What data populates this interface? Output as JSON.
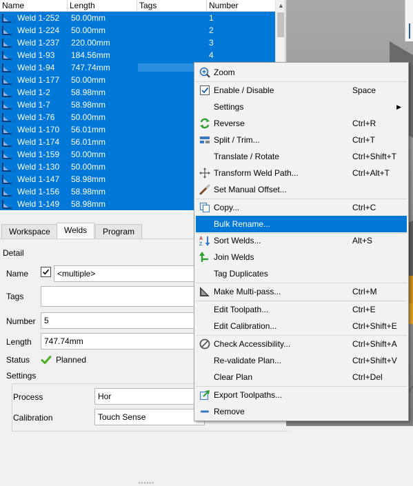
{
  "table": {
    "columns": [
      "Name",
      "Length",
      "Tags",
      "Number"
    ],
    "rows": [
      {
        "name": "Weld 1-252",
        "length": "50.00mm",
        "number": "1"
      },
      {
        "name": "Weld 1-224",
        "length": "50.00mm",
        "number": "2"
      },
      {
        "name": "Weld 1-237",
        "length": "220.00mm",
        "number": "3"
      },
      {
        "name": "Weld 1-93",
        "length": "184.56mm",
        "number": "4"
      },
      {
        "name": "Weld 1-94",
        "length": "747.74mm",
        "number": ""
      },
      {
        "name": "Weld 1-177",
        "length": "50.00mm",
        "number": ""
      },
      {
        "name": "Weld 1-2",
        "length": "58.98mm",
        "number": ""
      },
      {
        "name": "Weld 1-7",
        "length": "58.98mm",
        "number": ""
      },
      {
        "name": "Weld 1-76",
        "length": "50.00mm",
        "number": ""
      },
      {
        "name": "Weld 1-170",
        "length": "56.01mm",
        "number": ""
      },
      {
        "name": "Weld 1-174",
        "length": "56.01mm",
        "number": ""
      },
      {
        "name": "Weld 1-159",
        "length": "50.00mm",
        "number": ""
      },
      {
        "name": "Weld 1-130",
        "length": "50.00mm",
        "number": ""
      },
      {
        "name": "Weld 1-147",
        "length": "58.98mm",
        "number": ""
      },
      {
        "name": "Weld 1-156",
        "length": "58.98mm",
        "number": ""
      },
      {
        "name": "Weld 1-149",
        "length": "58.98mm",
        "number": ""
      }
    ],
    "selection_color": "#0078d7"
  },
  "tabs": [
    {
      "label": "Workspace",
      "active": false
    },
    {
      "label": "Welds",
      "active": true
    },
    {
      "label": "Program",
      "active": false
    }
  ],
  "detail": {
    "section_label": "Detail",
    "name_label": "Name",
    "name_value": "<multiple>",
    "name_checked": true,
    "tags_label": "Tags",
    "tags_value": "",
    "number_label": "Number",
    "number_value": "5",
    "length_label": "Length",
    "length_value": "747.74mm",
    "status_label": "Status",
    "status_value": "Planned",
    "status_color": "#4caf1e",
    "settings_label": "Settings",
    "process_label": "Process",
    "process_value": "Hor",
    "calibration_label": "Calibration",
    "calibration_value": "Touch Sense"
  },
  "menu": {
    "highlight_color": "#0078d7",
    "items": [
      {
        "label": "Zoom",
        "shortcut": "",
        "icon": "zoom-icon"
      },
      {
        "label": "Enable / Disable",
        "shortcut": "Space",
        "icon": "checkbox-icon"
      },
      {
        "label": "Settings",
        "shortcut": "",
        "icon": "",
        "submenu": true
      },
      {
        "label": "Reverse",
        "shortcut": "Ctrl+R",
        "icon": "reverse-icon"
      },
      {
        "label": "Split / Trim...",
        "shortcut": "Ctrl+T",
        "icon": "split-icon"
      },
      {
        "label": "Translate / Rotate",
        "shortcut": "Ctrl+Shift+T",
        "icon": ""
      },
      {
        "label": "Transform Weld Path...",
        "shortcut": "Ctrl+Alt+T",
        "icon": "transform-icon"
      },
      {
        "label": "Set Manual Offset...",
        "shortcut": "",
        "icon": "offset-icon"
      },
      {
        "label": "Copy...",
        "shortcut": "Ctrl+C",
        "icon": "copy-icon"
      },
      {
        "label": "Bulk Rename...",
        "shortcut": "",
        "icon": "",
        "highlighted": true
      },
      {
        "label": "Sort Welds...",
        "shortcut": "Alt+S",
        "icon": "sort-icon"
      },
      {
        "label": "Join Welds",
        "shortcut": "",
        "icon": "join-icon"
      },
      {
        "label": "Tag Duplicates",
        "shortcut": "",
        "icon": ""
      },
      {
        "label": "Make Multi-pass...",
        "shortcut": "Ctrl+M",
        "icon": "multipass-icon"
      },
      {
        "label": "Edit Toolpath...",
        "shortcut": "Ctrl+E",
        "icon": ""
      },
      {
        "label": "Edit Calibration...",
        "shortcut": "Ctrl+Shift+E",
        "icon": ""
      },
      {
        "label": "Check Accessibility...",
        "shortcut": "Ctrl+Shift+A",
        "icon": "no-entry-icon"
      },
      {
        "label": "Re-validate Plan...",
        "shortcut": "Ctrl+Shift+V",
        "icon": ""
      },
      {
        "label": "Clear Plan",
        "shortcut": "Ctrl+Del",
        "icon": ""
      },
      {
        "label": "Export Toolpaths...",
        "shortcut": "",
        "icon": "export-icon"
      },
      {
        "label": "Remove",
        "shortcut": "",
        "icon": "minus-icon"
      }
    ]
  }
}
